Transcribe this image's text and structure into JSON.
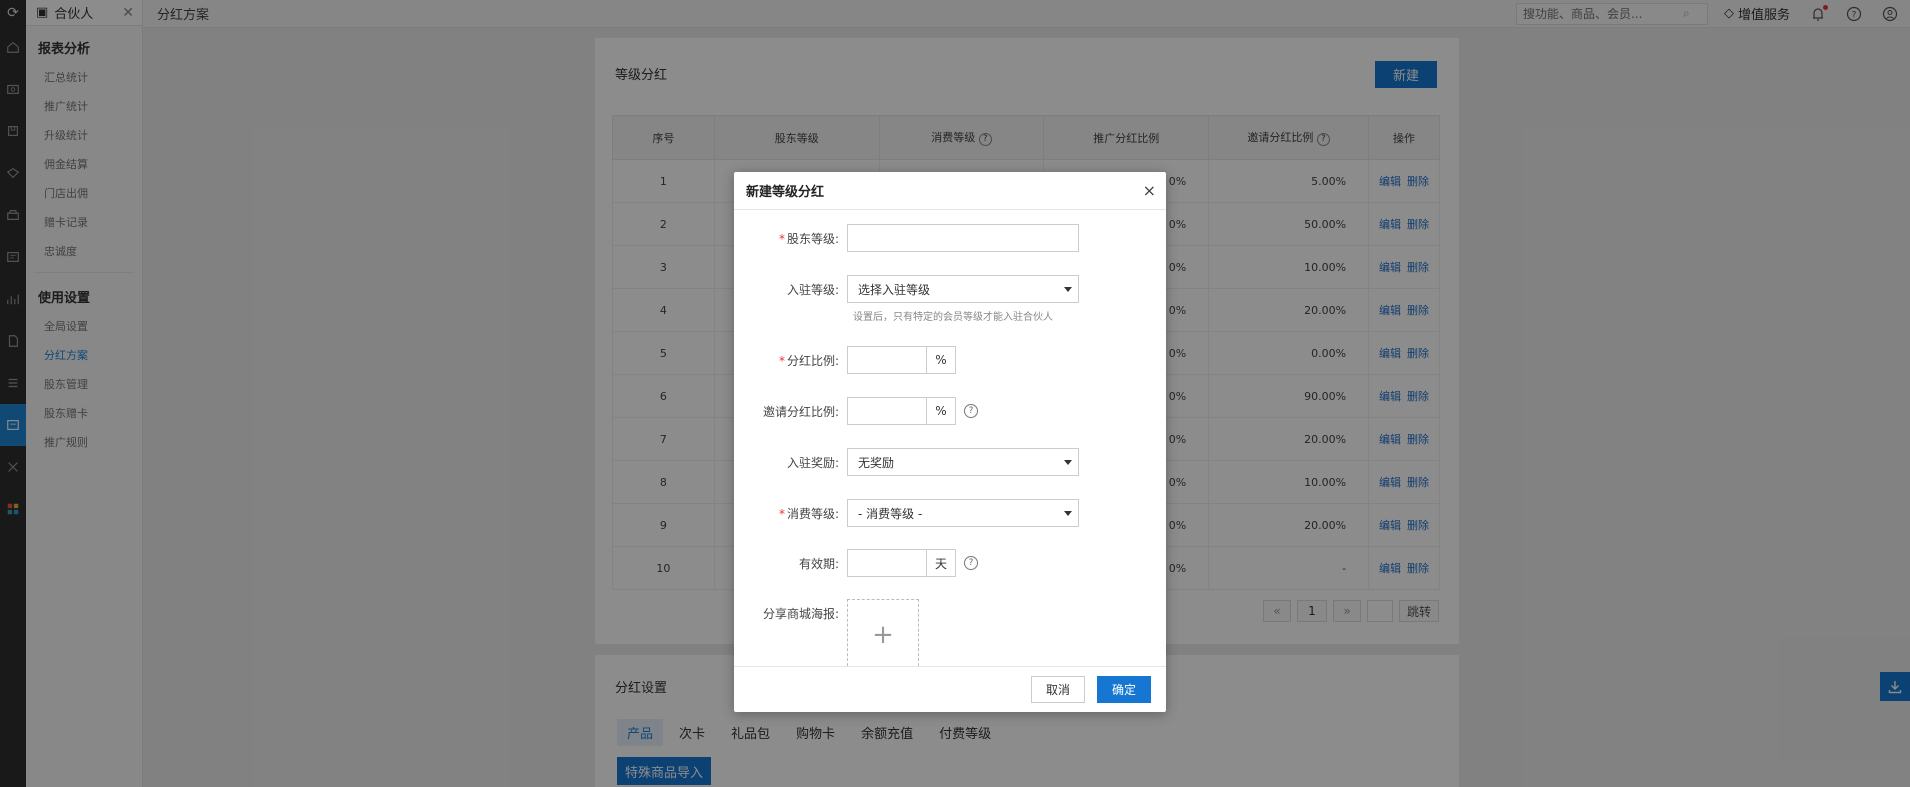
{
  "app": {
    "tab_title": "合伙人",
    "breadcrumb": "分红方案"
  },
  "header": {
    "search_placeholder": "搜功能、商品、会员...",
    "value_added": "增值服务"
  },
  "sidebar": {
    "groups": [
      {
        "title": "报表分析",
        "items": [
          "汇总统计",
          "推广统计",
          "升级统计",
          "佣金结算",
          "门店出佣",
          "赠卡记录",
          "忠诚度"
        ]
      },
      {
        "title": "使用设置",
        "items": [
          "全局设置",
          "分红方案",
          "股东管理",
          "股东赠卡",
          "推广规则"
        ]
      }
    ],
    "active_item": "分红方案"
  },
  "level_card": {
    "title": "等级分红",
    "new_button": "新建",
    "columns": [
      "序号",
      "股东等级",
      "消费等级",
      "推广分红比例",
      "邀请分红比例",
      "操作"
    ],
    "rows": [
      {
        "no": "1",
        "promo_tail": "0%",
        "invite": "5.00%"
      },
      {
        "no": "2",
        "promo_tail": "0%",
        "invite": "50.00%"
      },
      {
        "no": "3",
        "promo_tail": "0%",
        "invite": "10.00%"
      },
      {
        "no": "4",
        "promo_tail": "0%",
        "invite": "20.00%"
      },
      {
        "no": "5",
        "promo_tail": "0%",
        "invite": "0.00%"
      },
      {
        "no": "6",
        "promo_tail": "0%",
        "invite": "90.00%"
      },
      {
        "no": "7",
        "promo_tail": "0%",
        "invite": "20.00%"
      },
      {
        "no": "8",
        "promo_tail": "0%",
        "invite": "10.00%"
      },
      {
        "no": "9",
        "promo_tail": "0%",
        "invite": "20.00%"
      },
      {
        "no": "10",
        "promo_tail": "0%",
        "invite": "-"
      }
    ],
    "action_edit": "编辑",
    "action_delete": "删除",
    "pager": {
      "prev": "«",
      "current": "1",
      "next": "»",
      "jump": "跳转"
    }
  },
  "settings_card": {
    "title": "分红设置",
    "tabs": [
      "产品",
      "次卡",
      "礼品包",
      "购物卡",
      "余额充值",
      "付费等级"
    ],
    "active_tab": "产品",
    "import_button": "特殊商品导入"
  },
  "modal": {
    "title": "新建等级分红",
    "close": "×",
    "fields": {
      "shareholder_level": {
        "label": "股东等级:",
        "value": ""
      },
      "entry_level": {
        "label": "入驻等级:",
        "selected": "选择入驻等级",
        "hint": "设置后，只有特定的会员等级才能入驻合伙人"
      },
      "bonus_ratio": {
        "label": "分红比例:",
        "value": "",
        "unit": "%"
      },
      "invite_ratio": {
        "label": "邀请分红比例:",
        "value": "",
        "unit": "%"
      },
      "entry_reward": {
        "label": "入驻奖励:",
        "selected": "无奖励"
      },
      "consume_level": {
        "label": "消费等级:",
        "selected": "- 消费等级 -"
      },
      "validity": {
        "label": "有效期:",
        "value": "",
        "unit": "天"
      },
      "poster": {
        "label": "分享商城海报:"
      }
    },
    "cancel": "取消",
    "confirm": "确定"
  },
  "colors": {
    "primary": "#1677d2",
    "required": "#e33333",
    "link": "#1f6fc9"
  }
}
